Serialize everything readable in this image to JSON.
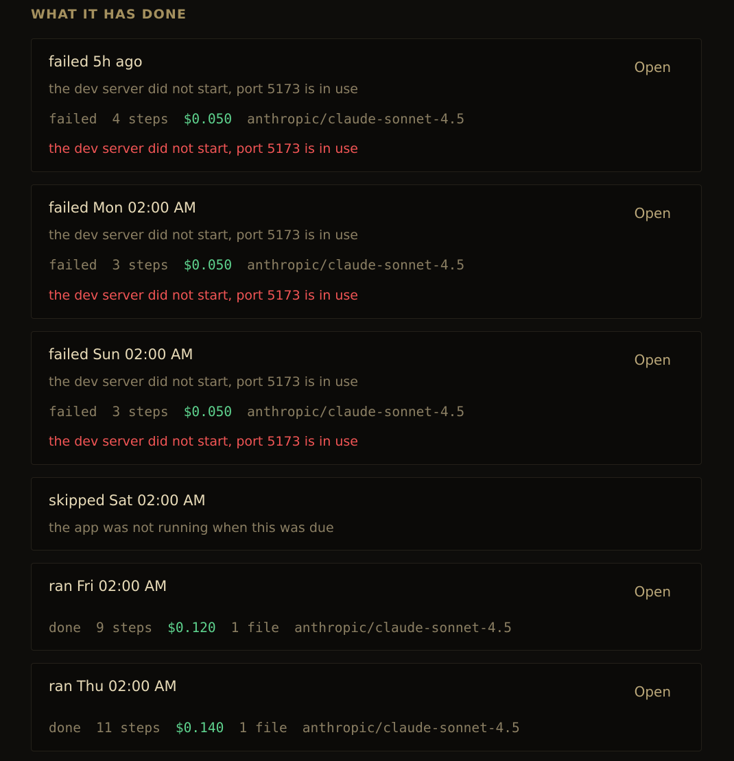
{
  "section": {
    "title": "WHAT IT HAS DONE"
  },
  "runs": [
    {
      "status_word": "failed",
      "when": "5h ago",
      "description": "the dev server did not start, port 5173 is in use",
      "meta_status": "failed",
      "steps": "4 steps",
      "cost": "$0.050",
      "model": "anthropic/claude-sonnet-4.5",
      "error": "the dev server did not start, port 5173 is in use",
      "open_label": "Open"
    },
    {
      "status_word": "failed",
      "when": "Mon 02:00 AM",
      "description": "the dev server did not start, port 5173 is in use",
      "meta_status": "failed",
      "steps": "3 steps",
      "cost": "$0.050",
      "model": "anthropic/claude-sonnet-4.5",
      "error": "the dev server did not start, port 5173 is in use",
      "open_label": "Open"
    },
    {
      "status_word": "failed",
      "when": "Sun 02:00 AM",
      "description": "the dev server did not start, port 5173 is in use",
      "meta_status": "failed",
      "steps": "3 steps",
      "cost": "$0.050",
      "model": "anthropic/claude-sonnet-4.5",
      "error": "the dev server did not start, port 5173 is in use",
      "open_label": "Open"
    },
    {
      "status_word": "skipped",
      "when": "Sat 02:00 AM",
      "description": "the app was not running when this was due"
    },
    {
      "status_word": "ran",
      "when": "Fri 02:00 AM",
      "meta_status": "done",
      "steps": "9 steps",
      "cost": "$0.120",
      "files": "1 file",
      "model": "anthropic/claude-sonnet-4.5",
      "open_label": "Open"
    },
    {
      "status_word": "ran",
      "when": "Thu 02:00 AM",
      "meta_status": "done",
      "steps": "11 steps",
      "cost": "$0.140",
      "files": "1 file",
      "model": "anthropic/claude-sonnet-4.5",
      "open_label": "Open"
    }
  ],
  "colors": {
    "background": "#0e0d0b",
    "section_title": "#a4905e",
    "cost": "#5ed38e",
    "error": "#f25555"
  }
}
